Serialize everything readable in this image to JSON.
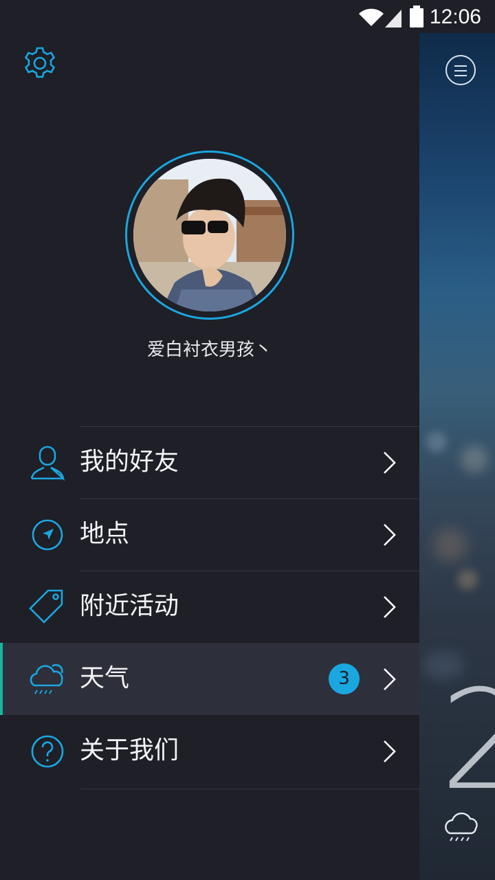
{
  "status_bar": {
    "time": "12:06",
    "icons": [
      "wifi-icon",
      "signal-icon",
      "battery-icon"
    ]
  },
  "drawer": {
    "settings_icon": "gear-icon",
    "profile": {
      "username": "爱白衬衣男孩丶"
    },
    "menu": [
      {
        "label": "我的好友",
        "icon": "user-icon",
        "badge": ""
      },
      {
        "label": "地点",
        "icon": "location-arrow-icon",
        "badge": ""
      },
      {
        "label": "附近活动",
        "icon": "tag-icon",
        "badge": ""
      },
      {
        "label": "天气",
        "icon": "rain-cloud-icon",
        "badge": "3",
        "active": true
      },
      {
        "label": "关于我们",
        "icon": "help-icon",
        "badge": ""
      }
    ]
  },
  "background_screen": {
    "menu_icon": "hamburger-menu-icon",
    "temperature": "2",
    "weather_icon": "rain-cloud-icon"
  },
  "colors": {
    "accent": "#1aa7e0",
    "active_indicator": "#19b5a0",
    "drawer_bg": "#1e1f27",
    "active_bg": "#2d2f3b"
  }
}
